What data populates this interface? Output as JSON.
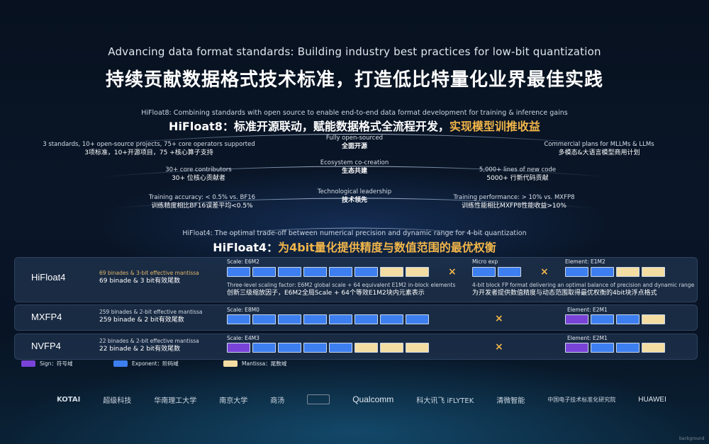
{
  "header": {
    "subtitle_en": "Advancing data format standards: Building industry best practices for low-bit quantization",
    "title_cn": "持续贡献数据格式技术标准，打造低比特量化业界最佳实践"
  },
  "hifloat8": {
    "en": "HiFloat8: Combining standards with open source to enable end-to-end data format development for training & inference gains",
    "cn_a": "HiFloat8：标准开源联动，赋能数据格式全流程开发，",
    "cn_b": "实现模型训推收益",
    "left": [
      {
        "en": "3 standards, 10+ open-source projects, 75+ core operators supported",
        "cn": "3项标准，10+开源项目，75 +核心算子支持"
      },
      {
        "en": "30+ core contributors",
        "cn": "30+ 位核心贡献者"
      },
      {
        "en": "Training accuracy: < 0.5% vs. BF16",
        "cn": "训练精度相比BF16误差平均<0.5%"
      }
    ],
    "center": [
      {
        "en": "Fully open-sourced",
        "cn": "全面开源"
      },
      {
        "en": "Ecosystem co-creation",
        "cn": "生态共建"
      },
      {
        "en": "Technological leadership",
        "cn": "技术领先"
      }
    ],
    "right": [
      {
        "en": "Commercial plans for MLLMs & LLMs",
        "cn": "多模态&大语言模型商用计划"
      },
      {
        "en": "5,000+ lines of new code",
        "cn": "5000+ 行新代码贡献"
      },
      {
        "en": "Training performance: > 10% vs. MXFP8",
        "cn": "训练性能相比MXFP8性能收益>10%"
      }
    ]
  },
  "hifloat4": {
    "en": "HiFloat4: The optimal trade-off between numerical precision and dynamic range for 4-bit quantization",
    "cn_a": "HiFloat4：",
    "cn_b": "为4bit量化提供精度与数值范围的最优权衡"
  },
  "formats": [
    {
      "name": "HiFloat4",
      "en": "69 binades & 3-bit effective mantissa",
      "cn": "69 binade & 3 bit有效尾数",
      "scale_label": "Scale: E6M2",
      "scale_cells": [
        "e",
        "e",
        "e",
        "e",
        "e",
        "e",
        "m",
        "m"
      ],
      "desc_en": "Three-level scaling factor: E6M2 global scale + 64 equivalent E1M2 in-block elements",
      "desc_cn": "创新三级缩放因子，E6M2全局Scale + 64个等效E1M2块内元素表示",
      "micro_label": "Micro exp",
      "micro_cells": [
        "e",
        "e"
      ],
      "element_label": "Element: E1M2",
      "element_cells": [
        "e",
        "e",
        "m",
        "m"
      ],
      "elem_desc_en": "4-bit block FP format delivering an optimal balance of precision and dynamic range",
      "elem_desc_cn": "为开发者提供数值精度与动态范围取得最优权衡的4bit块浮点格式",
      "cross": "×"
    },
    {
      "name": "MXFP4",
      "en": "259 binades & 2-bit effective mantissa",
      "cn": "259 binade & 2 bit有效尾数",
      "scale_label": "Scale: E8M0",
      "scale_cells": [
        "e",
        "e",
        "e",
        "e",
        "e",
        "e",
        "e",
        "e"
      ],
      "element_label": "Element: E2M1",
      "element_cells": [
        "s",
        "e",
        "e",
        "m"
      ],
      "cross": "×"
    },
    {
      "name": "NVFP4",
      "en": "22 binades & 2-bit effective mantissa",
      "cn": "22 binade & 2 bit有效尾数",
      "scale_label": "Scale: E4M3",
      "scale_cells": [
        "s",
        "e",
        "e",
        "e",
        "e",
        "m",
        "m",
        "m"
      ],
      "element_label": "Element: E2M1",
      "element_cells": [
        "s",
        "e",
        "e",
        "m"
      ],
      "cross": "×"
    }
  ],
  "legend": [
    {
      "label": "Sign：符号域",
      "color": "#7a43d8"
    },
    {
      "label": "Exponent：阶码域",
      "color": "#3d7ff0"
    },
    {
      "label": "Mantissa：尾数域",
      "color": "#f3dda2"
    }
  ],
  "logos": [
    "KOTAI",
    "超级科技",
    "华南理工大学",
    "南京大学",
    "商汤",
    "",
    "Qualcomm",
    "科大讯飞 iFLYTEK",
    "清微智能",
    "中国电子技术标准化研究院",
    "HUAWEI"
  ],
  "watermark": "background"
}
